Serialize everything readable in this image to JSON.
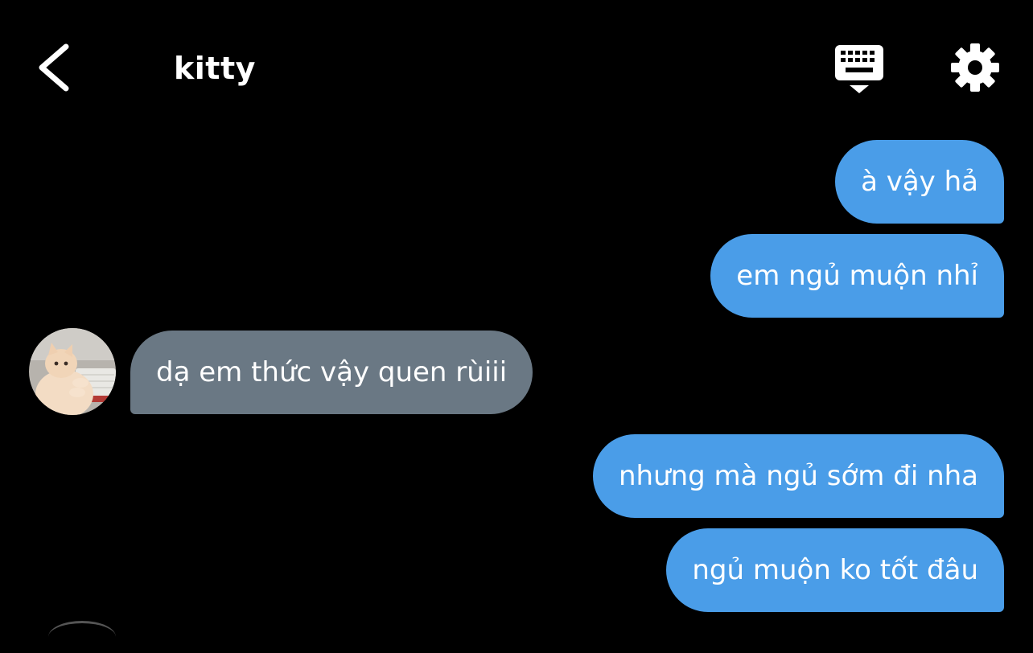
{
  "header": {
    "contact_name": "kitty",
    "icons": {
      "back": "chevron-left-icon",
      "keyboard": "keyboard-icon",
      "settings": "gear-icon"
    }
  },
  "colors": {
    "background": "#000000",
    "outgoing_bubble": "#4a9de8",
    "incoming_bubble": "#6a7884",
    "text": "#ffffff"
  },
  "messages": [
    {
      "direction": "outgoing",
      "text": "à vậy hả"
    },
    {
      "direction": "outgoing",
      "text": "em ngủ muộn nhỉ"
    },
    {
      "direction": "incoming",
      "text": "dạ em thức vậy quen rùiii"
    },
    {
      "direction": "outgoing",
      "text": "nhưng mà ngủ sớm đi nha"
    },
    {
      "direction": "outgoing",
      "text": "ngủ muộn ko tốt đâu"
    }
  ]
}
